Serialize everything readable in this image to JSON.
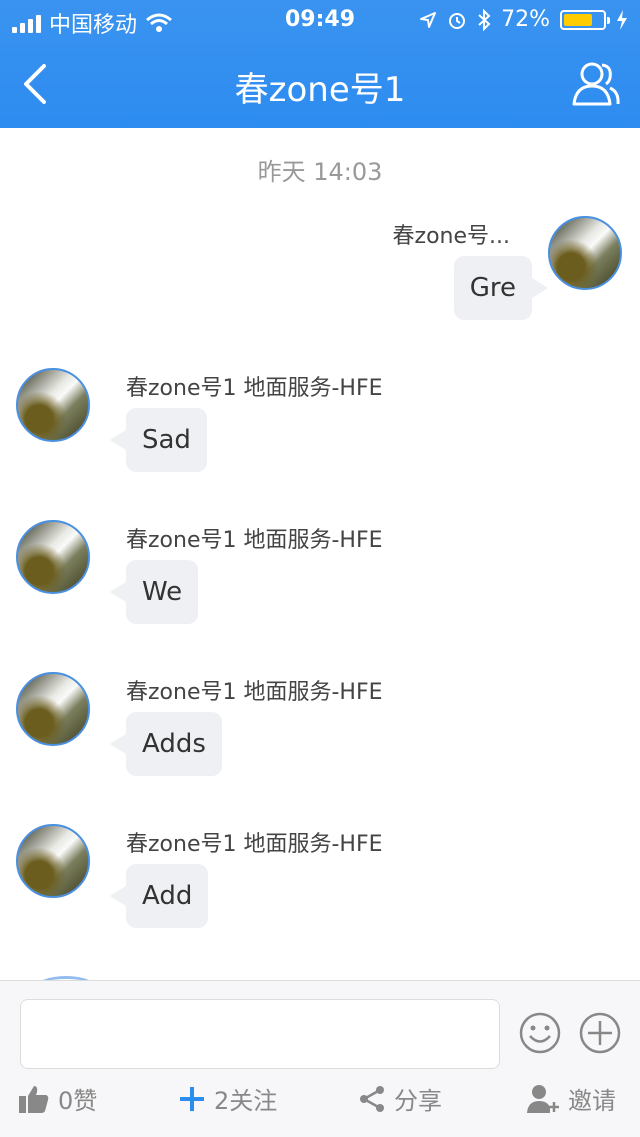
{
  "status": {
    "carrier": "中国移动",
    "time": "09:49",
    "battery": "72%"
  },
  "nav": {
    "title": "春zone号1"
  },
  "chat": {
    "timestamp": "昨天 14:03",
    "self": {
      "sender": "春zone号...",
      "text": "Gre"
    },
    "messages": [
      {
        "sender": "春zone号1 地面服务-HFE",
        "text": "Sad"
      },
      {
        "sender": "春zone号1 地面服务-HFE",
        "text": "We"
      },
      {
        "sender": "春zone号1 地面服务-HFE",
        "text": "Adds"
      },
      {
        "sender": "春zone号1 地面服务-HFE",
        "text": "Add"
      }
    ]
  },
  "input": {
    "placeholder": ""
  },
  "actions": {
    "like": "0赞",
    "follow": "2关注",
    "share": "分享",
    "invite": "邀请"
  },
  "colors": {
    "brand": "#2d8cf0",
    "battery": "#ffcc00",
    "bubble": "#eef0f4"
  }
}
